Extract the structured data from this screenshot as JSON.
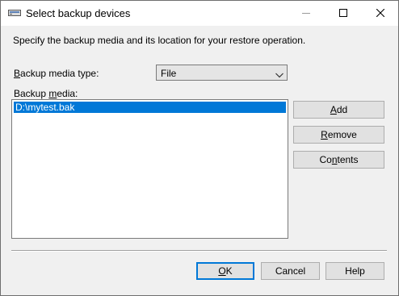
{
  "window": {
    "title": "Select backup devices",
    "icon": "backup-device-icon"
  },
  "titlebar_buttons": {
    "minimize_icon": "minimize-icon",
    "maximize_icon": "maximize-icon",
    "close_icon": "close-icon"
  },
  "intro_text": "Specify the backup media and its location for your restore operation.",
  "media_type": {
    "label_prefix": "",
    "label_mnemonic": "B",
    "label_rest": "ackup media type:",
    "selected": "File"
  },
  "media_list": {
    "label_prefix": "Backup ",
    "label_mnemonic": "m",
    "label_rest": "edia:",
    "items": [
      "D:\\mytest.bak"
    ]
  },
  "side_buttons": {
    "add": {
      "prefix": "",
      "mnemonic": "A",
      "rest": "dd"
    },
    "remove": {
      "prefix": "",
      "mnemonic": "R",
      "rest": "emove"
    },
    "contents": {
      "prefix": "Co",
      "mnemonic": "n",
      "rest": "tents"
    }
  },
  "footer_buttons": {
    "ok": {
      "prefix": "",
      "mnemonic": "O",
      "rest": "K"
    },
    "cancel": "Cancel",
    "help": "Help"
  },
  "colors": {
    "selection": "#0078d7",
    "dialog_bg": "#f0f0f0",
    "button_bg": "#e1e1e1"
  }
}
